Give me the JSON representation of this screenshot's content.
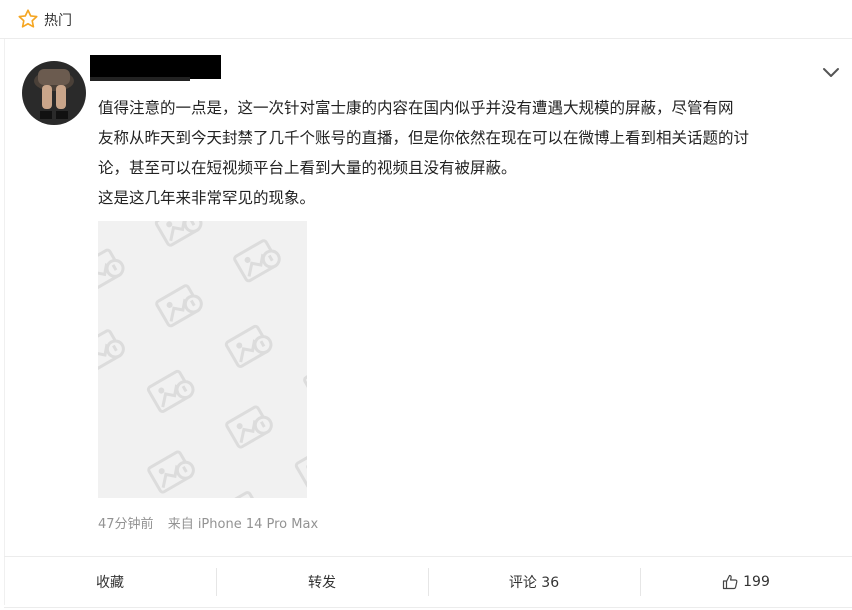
{
  "header": {
    "title": "热门",
    "icon": "star-icon",
    "icon_color": "#f5a623"
  },
  "post": {
    "author_redacted": true,
    "menu_icon": "chevron-down-icon",
    "lines": [
      "值得注意的一点是，这一次针对富士康的内容在国内似乎并没有遭遇大规模的屏蔽，尽管有网",
      "友称从昨天到今天封禁了几千个账号的直播，但是你依然在现在可以在微博上看到相关话题的讨",
      "论，甚至可以在短视频平台上看到大量的视频且没有被屏蔽。",
      "这是这几年来非常罕见的现象。"
    ],
    "image_placeholder_icon": "image-placeholder-icon",
    "time": "47分钟前",
    "source": "来自 iPhone 14 Pro Max"
  },
  "actions": {
    "favorite": "收藏",
    "repost": "转发",
    "comment": "评论 36",
    "like_count": "199",
    "like_icon": "thumbs-up-icon"
  }
}
